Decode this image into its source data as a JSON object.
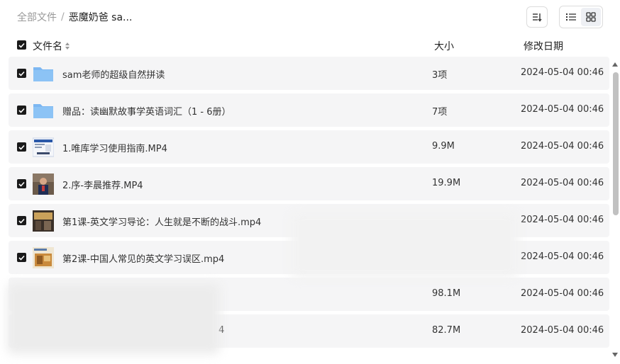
{
  "breadcrumb": {
    "root": "全部文件",
    "separator": "/",
    "current": "恶魔奶爸 sa..."
  },
  "columns": {
    "name": "文件名",
    "size": "大小",
    "modified": "修改日期"
  },
  "rows": [
    {
      "name": "sam老师的超级自然拼读",
      "size": "3项",
      "modified": "2024-05-04 00:46",
      "type": "folder"
    },
    {
      "name": "赠品：读幽默故事学英语词汇（1 - 6册）",
      "size": "7项",
      "modified": "2024-05-04 00:46",
      "type": "folder"
    },
    {
      "name": "1.唯库学习使用指南.MP4",
      "size": "9.9M",
      "modified": "2024-05-04 00:46",
      "type": "video"
    },
    {
      "name": "2.序-李晨推荐.MP4",
      "size": "19.9M",
      "modified": "2024-05-04 00:46",
      "type": "video"
    },
    {
      "name": "第1课-英文学习导论：人生就是不断的战斗.mp4",
      "size": "",
      "modified": "2024-05-04 00:46",
      "type": "video"
    },
    {
      "name": "第2课-中国人常见的英文学习误区.mp4",
      "size": "",
      "modified": "2024-05-04 00:46",
      "type": "video"
    },
    {
      "name": "",
      "size": "98.1M",
      "modified": "2024-05-04 00:46",
      "type": "video"
    },
    {
      "name": "4",
      "size": "82.7M",
      "modified": "2024-05-04 00:46",
      "type": "video"
    }
  ],
  "icons": {
    "sort": "sort-icon",
    "list_view": "list-view-icon",
    "grid_view": "grid-view-icon",
    "checkbox": "checkbox-checked-icon",
    "folder": "folder-icon"
  },
  "colors": {
    "folder": "#7cb7f2",
    "checkbox": "#1a1a1a",
    "row_bg": "#f5f5f6"
  }
}
